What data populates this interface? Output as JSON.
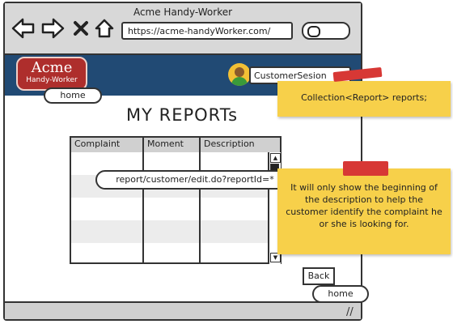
{
  "window": {
    "title": "Acme Handy-Worker"
  },
  "addressbar": {
    "url": "https://acme-handyWorker.com/"
  },
  "header": {
    "logo_line1": "Acme",
    "logo_line2": "Handy-Worker",
    "user_label": "CustomerSesion"
  },
  "callouts": {
    "logo_link": "home",
    "row_link": "report/customer/edit.do?reportId=*",
    "back_link": "home"
  },
  "main": {
    "title": "MY REPORTs",
    "table": {
      "columns": [
        "Complaint",
        "Moment",
        "Description"
      ],
      "rows": 5
    },
    "back_label": "Back"
  },
  "notes": {
    "note1": "Collection<Report> reports;",
    "note2": "It will only show the beginning of the description to help the customer identify the complaint he or she is looking for."
  },
  "colors": {
    "header_bg": "#214a74",
    "logo_bg": "#ae2e2c",
    "note_bg": "#f7d04a",
    "tape": "#d73835"
  },
  "icons": [
    "back-arrow-icon",
    "forward-arrow-icon",
    "close-icon",
    "home-icon",
    "search-icon",
    "user-avatar-icon",
    "dropdown-arrow-icon",
    "resize-grip-icon"
  ]
}
